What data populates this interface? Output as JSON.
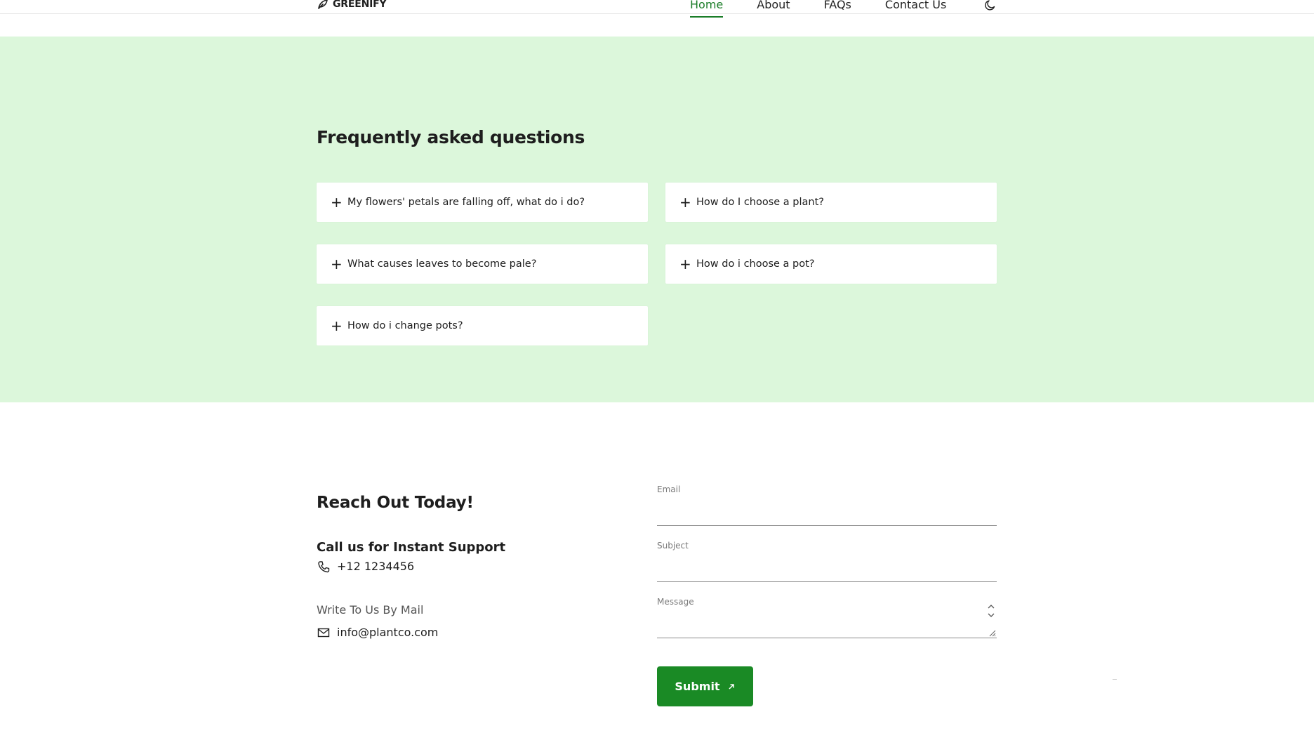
{
  "brand": {
    "name": "GREENIFY"
  },
  "nav": {
    "items": [
      {
        "label": "Home",
        "active": true
      },
      {
        "label": "About",
        "active": false
      },
      {
        "label": "FAQs",
        "active": false
      },
      {
        "label": "Contact Us",
        "active": false
      }
    ]
  },
  "faq": {
    "title": "Frequently asked questions",
    "items": [
      {
        "question": "My flowers' petals are falling off, what do i do?"
      },
      {
        "question": "How do I choose a plant?"
      },
      {
        "question": "What causes leaves to become pale?"
      },
      {
        "question": "How do i choose a pot?"
      },
      {
        "question": "How do i change pots?"
      }
    ]
  },
  "contact": {
    "heading": "Reach Out Today!",
    "support_heading": "Call us for Instant Support",
    "phone": "+12 1234456",
    "mail_heading": "Write To Us By Mail",
    "email": "info@plantco.com"
  },
  "form": {
    "email_label": "Email",
    "subject_label": "Subject",
    "message_label": "Message",
    "submit_label": "Submit"
  },
  "colors": {
    "accent": "#1b7d28",
    "faq_bg": "#dcf7db",
    "button": "#1a8a25"
  }
}
